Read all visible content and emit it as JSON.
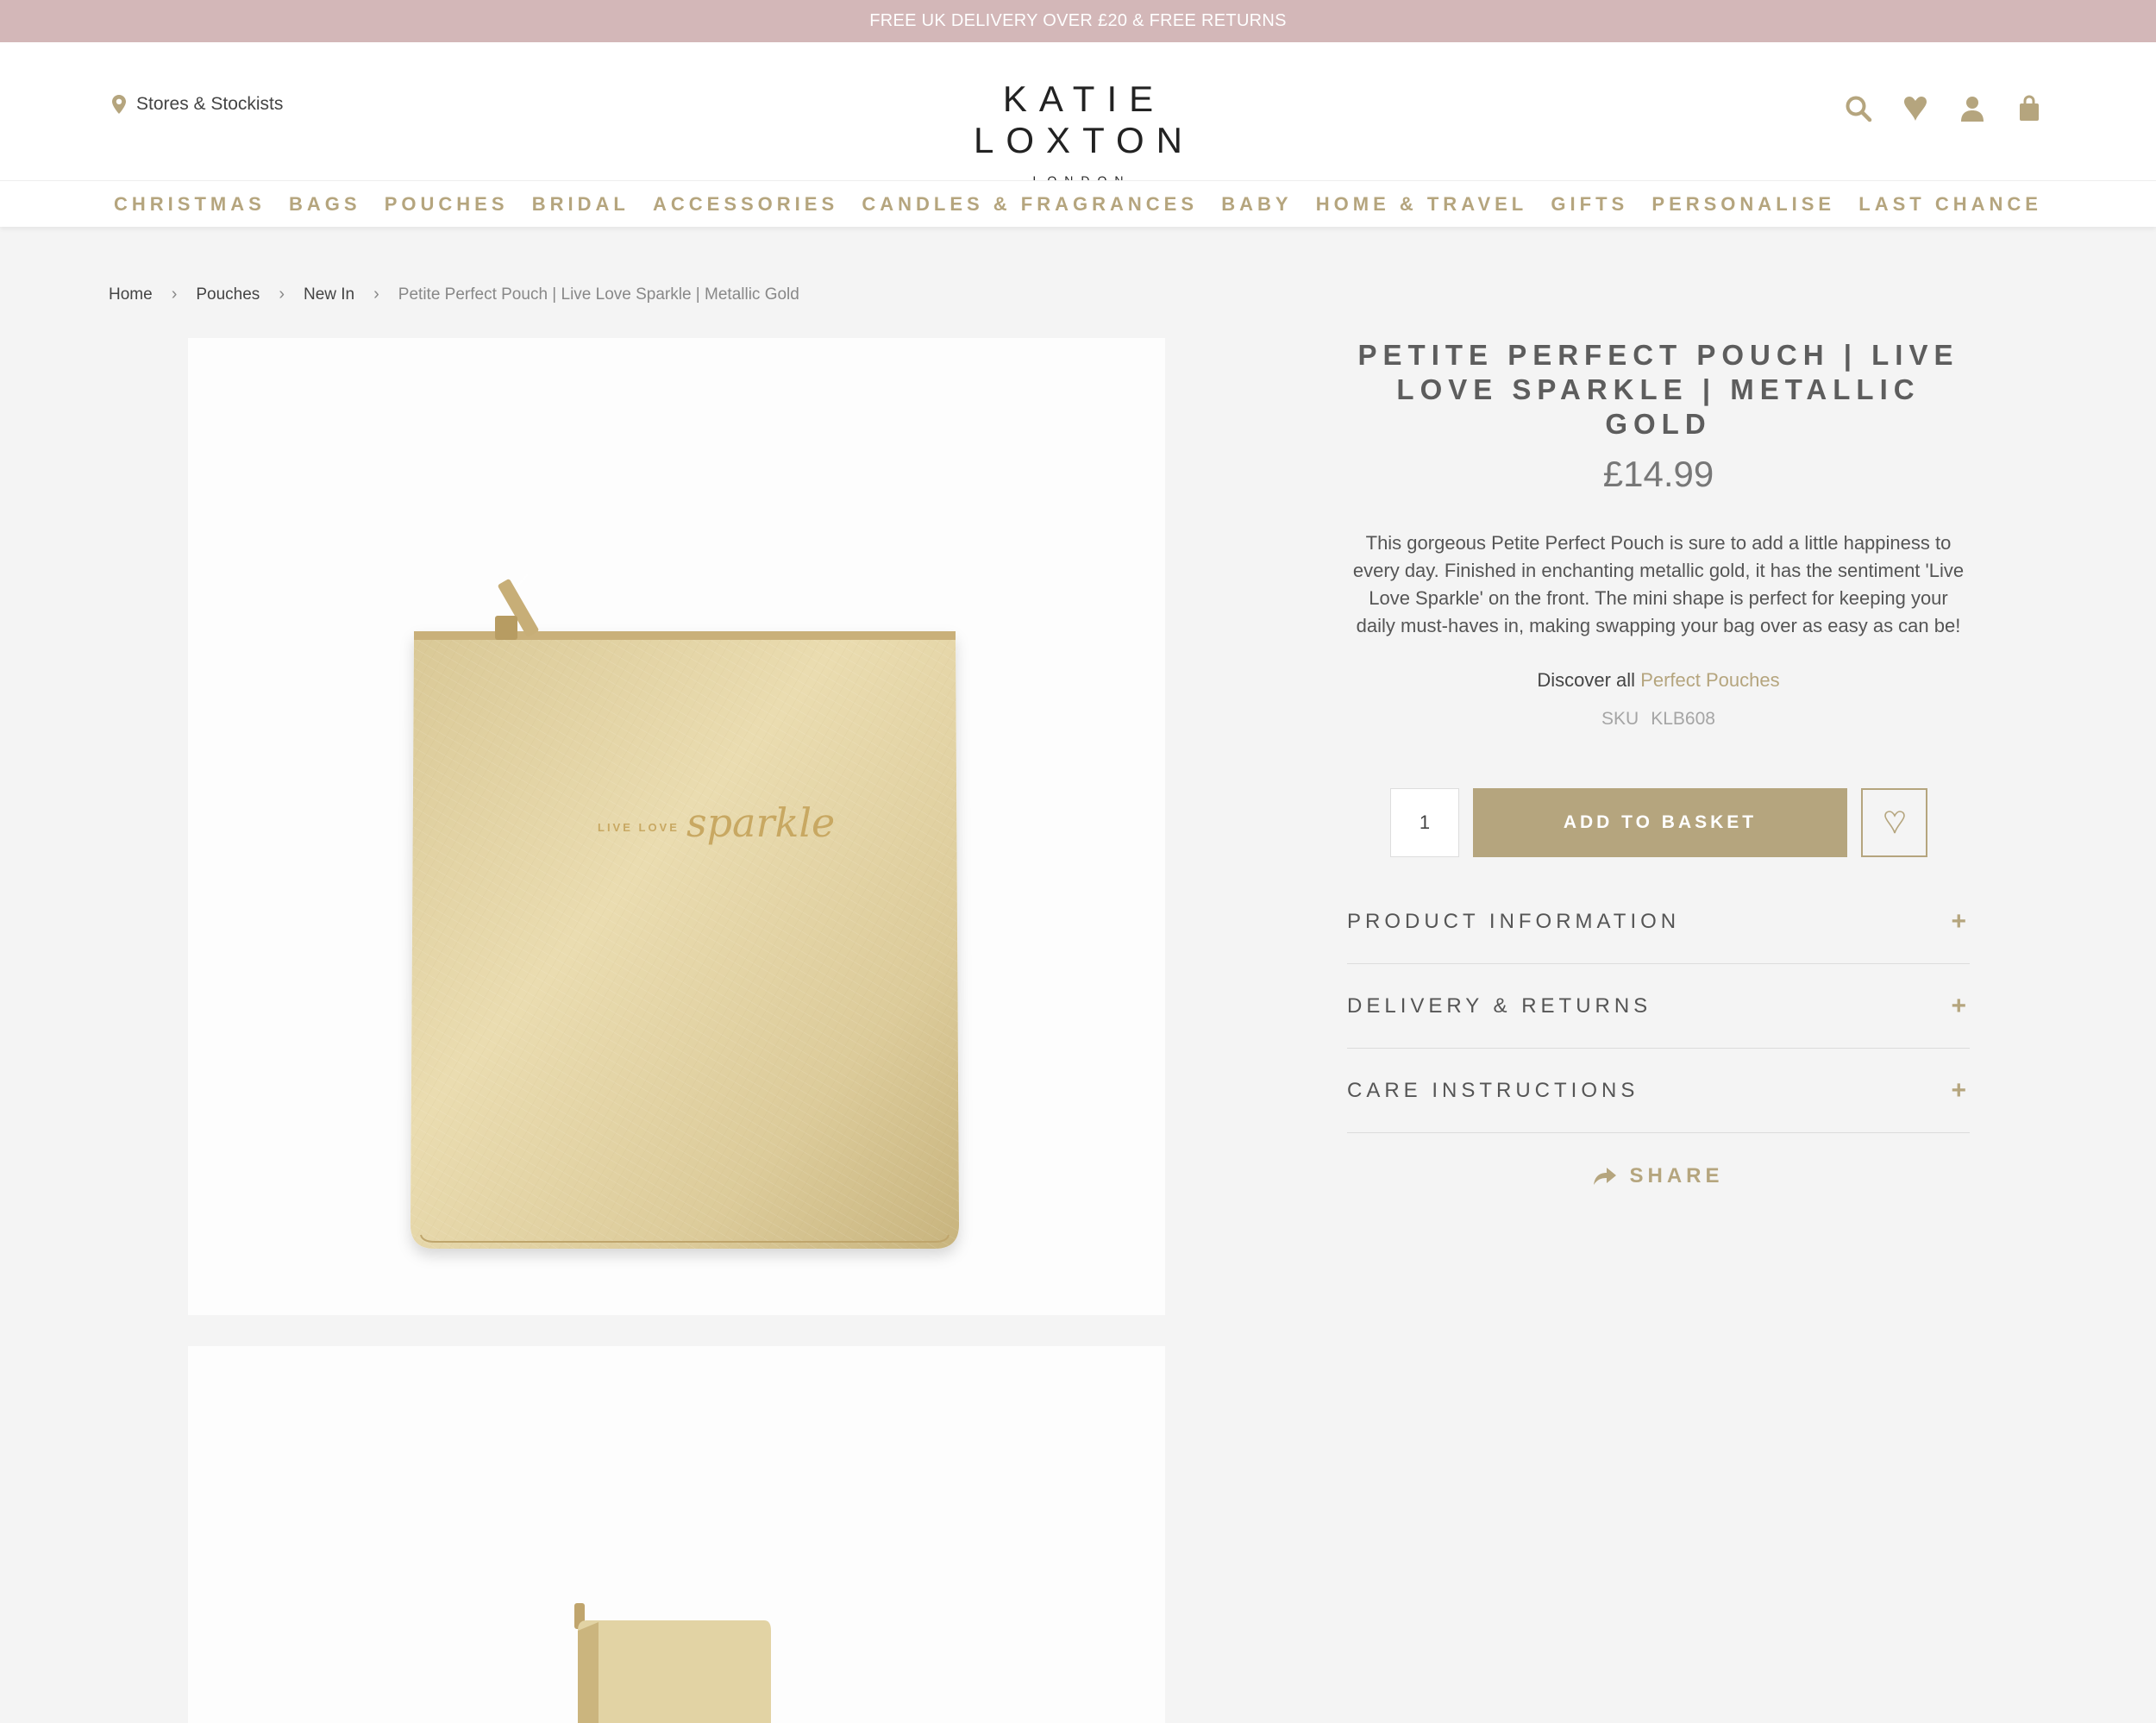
{
  "promo": {
    "text": "FREE UK DELIVERY OVER £20 & FREE RETURNS"
  },
  "header": {
    "stores_label": "Stores & Stockists",
    "logo_main": "KATIE LOXTON",
    "logo_sub": "LONDON",
    "icons": [
      "search-icon",
      "heart-icon",
      "user-icon",
      "basket-icon"
    ]
  },
  "nav": [
    "CHRISTMAS",
    "BAGS",
    "POUCHES",
    "BRIDAL",
    "ACCESSORIES",
    "CANDLES & FRAGRANCES",
    "BABY",
    "HOME & TRAVEL",
    "GIFTS",
    "PERSONALISE",
    "LAST CHANCE"
  ],
  "breadcrumb": [
    "Home",
    "Pouches",
    "New In",
    "Petite Perfect Pouch | Live Love Sparkle | Metallic Gold"
  ],
  "product": {
    "title": "PETITE PERFECT POUCH | LIVE LOVE SPARKLE | METALLIC GOLD",
    "price": "£14.99",
    "description": "This gorgeous Petite Perfect Pouch is sure to add a little happiness to every day. Finished in enchanting metallic gold, it has the sentiment 'Live Love Sparkle' on the front. The mini shape is perfect for keeping your daily must-haves in, making swapping your bag over as easy as can be!",
    "discover_prefix": "Discover all",
    "discover_link": "Perfect Pouches",
    "sku_label": "SKU",
    "sku_value": "KLB608",
    "quantity": "1",
    "add_label": "ADD TO BASKET",
    "pouch_text_small": "LIVE LOVE",
    "pouch_text_script": "sparkle"
  },
  "accordion": [
    "PRODUCT INFORMATION",
    "DELIVERY & RETURNS",
    "CARE INSTRUCTIONS"
  ],
  "accordion_symbol": "+",
  "share_label": "SHARE",
  "colors": {
    "gold": "#b5a57e",
    "promo_bg": "#d3b7b8",
    "page_bg": "#f4f4f4"
  }
}
